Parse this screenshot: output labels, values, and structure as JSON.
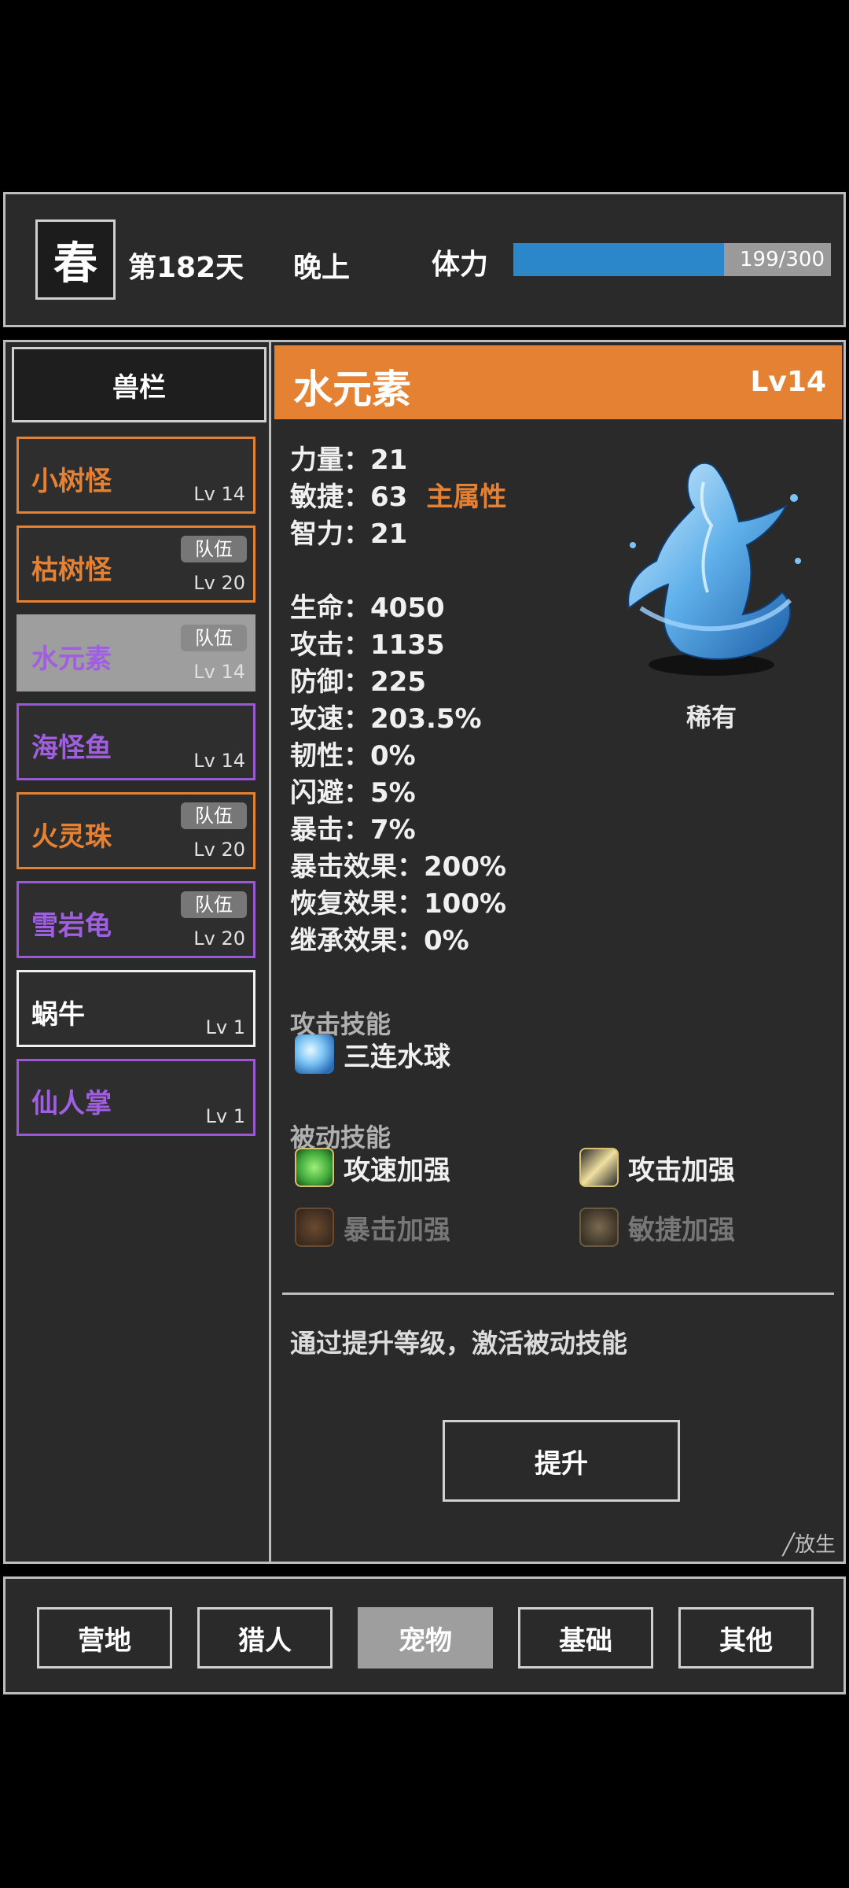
{
  "header": {
    "season": "春",
    "day": "第182天",
    "period": "晚上",
    "stamina_label": "体力",
    "stamina_current": 199,
    "stamina_max": 300,
    "stamina_text": "199/300"
  },
  "pet_list": {
    "title": "兽栏",
    "items": [
      {
        "name": "小树怪",
        "level": "Lv 14",
        "team": "",
        "rarity_color": "orange"
      },
      {
        "name": "枯树怪",
        "level": "Lv 20",
        "team": "队伍",
        "rarity_color": "orange"
      },
      {
        "name": "水元素",
        "level": "Lv 14",
        "team": "队伍",
        "rarity_color": "purple",
        "selected": true
      },
      {
        "name": "海怪鱼",
        "level": "Lv 14",
        "team": "",
        "rarity_color": "purple"
      },
      {
        "name": "火灵珠",
        "level": "Lv 20",
        "team": "队伍",
        "rarity_color": "orange"
      },
      {
        "name": "雪岩龟",
        "level": "Lv 20",
        "team": "队伍",
        "rarity_color": "purple"
      },
      {
        "name": "蜗牛",
        "level": "Lv 1",
        "team": "",
        "rarity_color": "white"
      },
      {
        "name": "仙人掌",
        "level": "Lv 1",
        "team": "",
        "rarity_color": "purple"
      }
    ]
  },
  "detail": {
    "name": "水元素",
    "level": "Lv14",
    "rarity": "稀有",
    "stats": [
      {
        "text": "力量：21"
      },
      {
        "text": "敏捷：63",
        "tag": "主属性"
      },
      {
        "text": "智力：21"
      },
      {
        "text": "生命：4050"
      },
      {
        "text": "攻击：1135"
      },
      {
        "text": "防御：225"
      },
      {
        "text": "攻速：203.5%"
      },
      {
        "text": "韧性：0%"
      },
      {
        "text": "闪避：5%"
      },
      {
        "text": "暴击：7%"
      },
      {
        "text": "暴击效果：200%"
      },
      {
        "text": "恢复效果：100%"
      },
      {
        "text": "继承效果：0%"
      }
    ],
    "attack_skills_title": "攻击技能",
    "attack_skills": [
      {
        "name": "三连水球",
        "icon": "water-orb-icon"
      }
    ],
    "passive_skills_title": "被动技能",
    "passive_skills": [
      {
        "name": "攻速加强",
        "icon": "tornado-icon",
        "active": true
      },
      {
        "name": "攻击加强",
        "icon": "sword-icon",
        "active": true
      },
      {
        "name": "暴击加强",
        "icon": "claw-icon",
        "active": false
      },
      {
        "name": "敏捷加强",
        "icon": "agi-icon",
        "active": false
      }
    ],
    "hint": "通过提升等级，激活被动技能",
    "upgrade_label": "提升",
    "release_label": "╱放生"
  },
  "bottom_nav": {
    "items": [
      "营地",
      "猎人",
      "宠物",
      "基础",
      "其他"
    ],
    "active": "宠物"
  },
  "colors": {
    "accent_orange": "#e58133",
    "rarity_purple": "#a05ee0",
    "stamina_blue": "#2b87c9"
  }
}
